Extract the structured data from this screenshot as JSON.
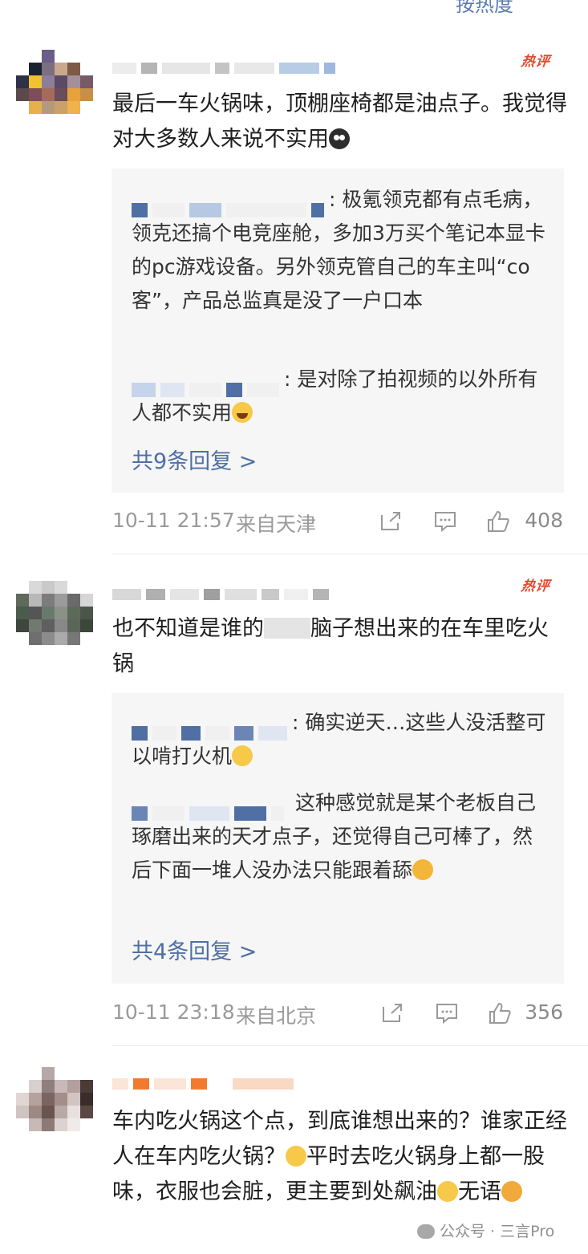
{
  "top_sort": {
    "label": "按热度"
  },
  "comments": [
    {
      "hot_label": "热评",
      "text": "最后一车火锅味，顶棚座椅都是油点子。我觉得对大多数人来说不实用",
      "emoji": "crying-face",
      "replies": [
        {
          "text": "极氪领克都有点毛病，领克还搞个电竞座舱，多加3万买个笔记本显卡的pc游戏设备。另外领克管自己的车主叫“co客”，产品总监真是没了一户口本"
        },
        {
          "text": "是对除了拍视频的以外所有人都不实用",
          "emoji": "laughing-face"
        }
      ],
      "more_replies": "共9条回复 >",
      "time": "10-11 21:57",
      "location": "来自天津",
      "likes": "408"
    },
    {
      "hot_label": "热评",
      "text_before": "也不知道是谁的",
      "text_after": "脑子想出来的在车里吃火锅",
      "replies": [
        {
          "text": "确实逆天…这些人没活整可以啃打火机",
          "emoji": "shrug-face"
        },
        {
          "text": "这种感觉就是某个老板自己琢磨出来的天才点子，还觉得自己可棒了，然后下面一堆人没办法只能跟着舔",
          "emoji": "scared-face"
        }
      ],
      "more_replies": "共4条回复 >",
      "time": "10-11 23:18",
      "location": "来自北京",
      "likes": "356"
    },
    {
      "text": "车内吃火锅这个点，到底谁想出来的？谁家正经人在车内吃火锅？",
      "text_2": "平时去吃火锅身上都一股味，衣服也会脏，更主要到处飙油",
      "text_3": "无语"
    }
  ],
  "watermark": "公众号 · 三言Pro"
}
